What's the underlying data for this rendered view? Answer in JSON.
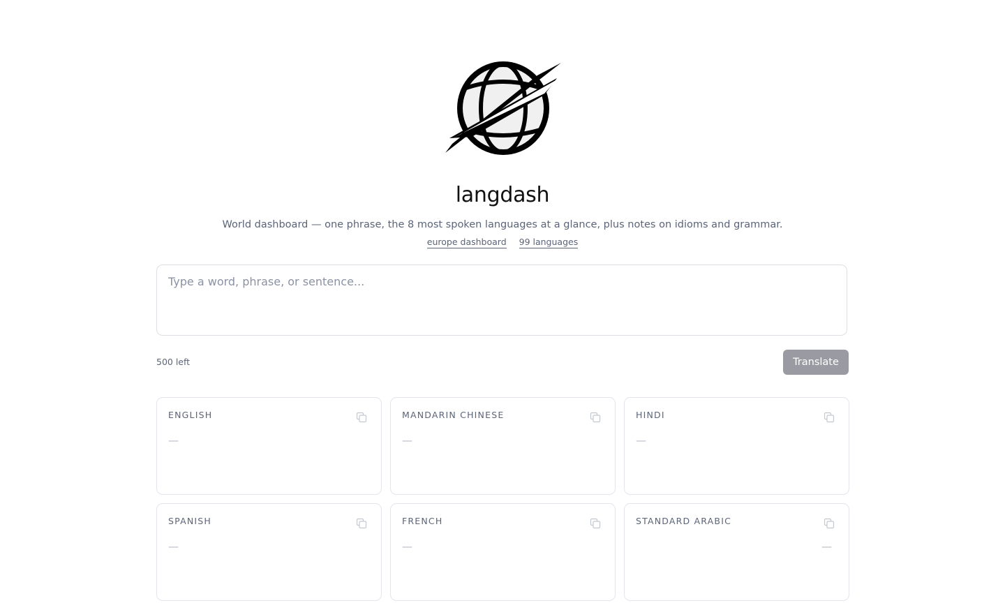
{
  "header": {
    "logo_icon": "globe-logo-icon",
    "title": "langdash",
    "subtitle": "World dashboard — one phrase, the 8 most spoken languages at a glance, plus notes on idioms and grammar.",
    "links": [
      {
        "label": "europe dashboard"
      },
      {
        "label": "99 languages"
      }
    ]
  },
  "input": {
    "placeholder": "Type a word, phrase, or sentence...",
    "value": "",
    "counter": "500 left",
    "translate_label": "Translate"
  },
  "cards": [
    {
      "language": "ENGLISH",
      "value": "—",
      "copy_icon": "copy-icon"
    },
    {
      "language": "MANDARIN CHINESE",
      "value": "—",
      "copy_icon": "copy-icon"
    },
    {
      "language": "HINDI",
      "value": "—",
      "copy_icon": "copy-icon"
    },
    {
      "language": "SPANISH",
      "value": "—",
      "copy_icon": "copy-icon"
    },
    {
      "language": "FRENCH",
      "value": "—",
      "copy_icon": "copy-icon"
    },
    {
      "language": "STANDARD ARABIC",
      "value": "—",
      "copy_icon": "copy-icon",
      "rtl": true
    }
  ],
  "colors": {
    "text": "#111111",
    "muted": "#5b6478",
    "border": "#dcdfe4",
    "button_bg": "#9a9aa2"
  }
}
